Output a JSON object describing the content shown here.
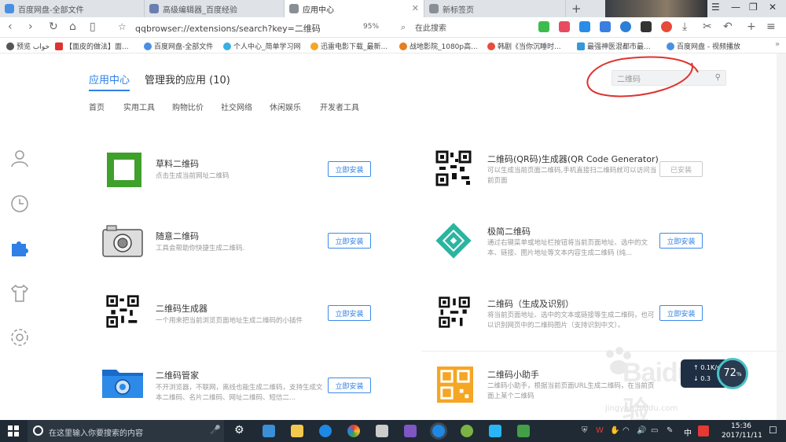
{
  "tabs": [
    {
      "label": "百度网盘-全部文件",
      "color": "#4a90e2"
    },
    {
      "label": "高级编辑器_百度经验",
      "color": "#6a7fb0"
    },
    {
      "label": "应用中心",
      "color": "#8a8f96"
    },
    {
      "label": "新标签页",
      "color": "#8a8f96"
    }
  ],
  "address": {
    "url": "qqbrowser://extensions/search?key=二维码",
    "zoom": "95%",
    "search_placeholder": "在此搜索"
  },
  "bookmarks": [
    "预览 خواب",
    "【面皮的做法】面...",
    "百度网盘-全部文件",
    "个人中心_简单学习网",
    "迅雷电影下载_最新...",
    "战地影院_1080p高...",
    "韩剧《当你沉睡时...",
    "最强神医混都市最...",
    "百度网盘 - 视频播放"
  ],
  "header": {
    "tab_center": "应用中心",
    "tab_manage": "管理我的应用 (10)",
    "search_value": "二维码"
  },
  "categories": [
    "首页",
    "实用工具",
    "购物比价",
    "社交网络",
    "休闲娱乐",
    "开发者工具"
  ],
  "apps": [
    {
      "title": "草料二维码",
      "desc": "点击生成当前网址二维码",
      "button": "立即安装"
    },
    {
      "title": "二维码(QR码)生成器(QR Code Generator)",
      "desc": "可以生成当前页面二维码,手机直接扫二维码就可以访问当前页面",
      "button": "已安装"
    },
    {
      "title": "随意二维码",
      "desc": "工具会帮助你快捷生成二维码.",
      "button": "立即安装"
    },
    {
      "title": "极简二维码",
      "desc": "通过右键菜单或地址栏按钮将当前页面地址、选中的文本、链接、图片地址等文本内容生成二维码 (纯...",
      "button": "立即安装"
    },
    {
      "title": "二维码生成器",
      "desc": "一个用来把当前浏览页面地址生成二维码的小插件",
      "button": "立即安装"
    },
    {
      "title": "二维码（生成及识别）",
      "desc": "将当前页面地址、选中的文本或链接等生成二维码，也可以识别网页中的二维码图片（支持识别中文）。",
      "button": "立即安装"
    },
    {
      "title": "二维码管家",
      "desc": "不开浏览器，不联网，离线也能生成二维码，支持生成文本二维码、名片二维码、网址二维码、短信二...",
      "button": "立即安装"
    },
    {
      "title": "二维码小助手",
      "desc": "二维码小助手，根据当前页面URL生成二维码，在当前页面上某个二维码",
      "button": ""
    }
  ],
  "speed": {
    "up": "0.1",
    "up_unit": "K/s",
    "down": "0.3",
    "percent": "72",
    "percent_unit": "%"
  },
  "watermark": {
    "brand": "Baidu经验",
    "url": "jingyan.baidu.com"
  },
  "taskbar": {
    "search_placeholder": "在这里输入你要搜索的内容",
    "ime": "中",
    "time": "15:36",
    "date": "2017/11/11"
  }
}
